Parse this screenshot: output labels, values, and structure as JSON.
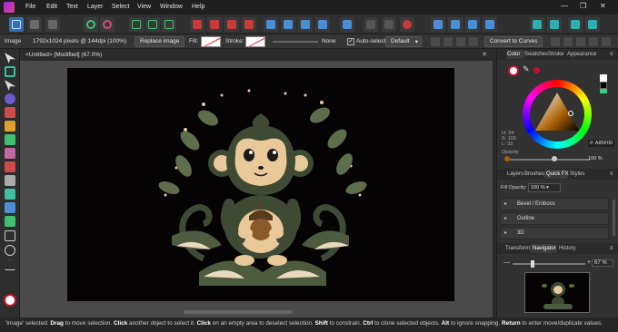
{
  "menu": [
    "File",
    "Edit",
    "Text",
    "Layer",
    "Select",
    "View",
    "Window",
    "Help"
  ],
  "context": {
    "layer_type": "Image",
    "image_info": "1792x1024 pixels @ 144dpi (100%)",
    "replace_image": "Replace image",
    "fill_label": "Fill:",
    "stroke_label": "Stroke:",
    "stroke_value": "None",
    "auto_select_label": "Auto-select:",
    "auto_select_value": "Default",
    "convert_to_curves": "Convert to Curves"
  },
  "document": {
    "title": "<Untitled> [Modified] (67.0%)"
  },
  "panels": {
    "top_tabs": [
      "Color",
      "Swatches",
      "Stroke",
      "Appearance"
    ],
    "hsl": {
      "h": "H: 34",
      "s": "S: 100",
      "l": "L: 33"
    },
    "hex": "#: A85F00",
    "opacity_label": "Opacity",
    "opacity_value": "100 %",
    "mid_tabs": [
      "Layers",
      "Brushes",
      "Quick FX",
      "Styles"
    ],
    "fill_opacity_label": "Fill Opacity:",
    "fill_opacity_value": "100 %",
    "fx": [
      "Bevel / Emboss",
      "Outline",
      "3D"
    ],
    "bottom_tabs": [
      "Transform",
      "Navigator",
      "History"
    ],
    "zoom_value": "67 %"
  },
  "status": {
    "parts": [
      {
        "t": "'Image' selected. ",
        "b": false
      },
      {
        "t": "Drag",
        "b": true
      },
      {
        "t": " to move selection. ",
        "b": false
      },
      {
        "t": "Click",
        "b": true
      },
      {
        "t": " another object to select it. ",
        "b": false
      },
      {
        "t": "Click",
        "b": true
      },
      {
        "t": " on an empty area to deselect selection. ",
        "b": false
      },
      {
        "t": "Shift",
        "b": true
      },
      {
        "t": " to constrain. ",
        "b": false
      },
      {
        "t": "Ctrl",
        "b": true
      },
      {
        "t": " to clone selected objects. ",
        "b": false
      },
      {
        "t": "Alt",
        "b": true
      },
      {
        "t": " to ignore snapping. ",
        "b": false
      },
      {
        "t": "Return",
        "b": true
      },
      {
        "t": " to enter move/duplicate values.",
        "b": false
      }
    ]
  },
  "colors": {
    "accent": "#2f6fbf",
    "monkey_fur": "#3e4a33",
    "monkey_face": "#e9c89a",
    "leaf": "#5d6e4c",
    "acorn": "#8a5a2b",
    "selected_color": "#a85f00"
  }
}
